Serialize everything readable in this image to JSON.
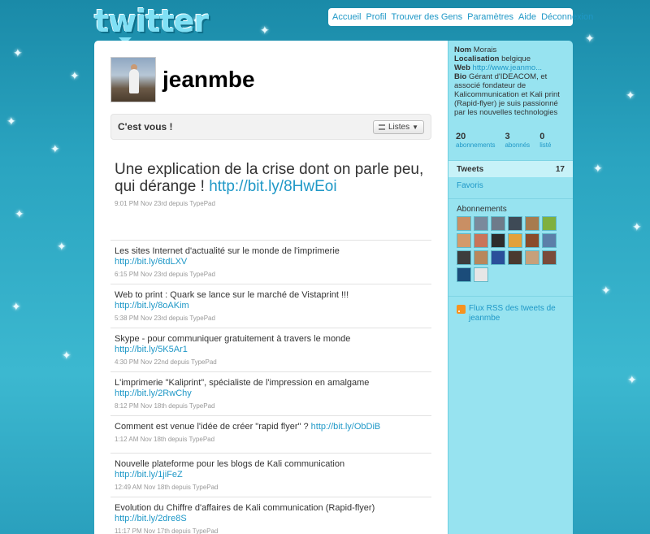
{
  "brand": {
    "logo": "twitter"
  },
  "nav": {
    "items": [
      "Accueil",
      "Profil",
      "Trouver des Gens",
      "Paramètres",
      "Aide",
      "Déconnexion"
    ]
  },
  "profile": {
    "username": "jeanmbe",
    "you_label": "C'est vous !",
    "lists_label": "Listes"
  },
  "latest_tweet": {
    "text": "Une explication de la crise dont on parle peu, qui dérange ! ",
    "link": "http://bit.ly/8HwEoi",
    "meta": "9:01 PM Nov 23rd depuis TypePad"
  },
  "tweets": [
    {
      "text": "Les sites Internet d'actualité sur le monde de l'imprimerie",
      "link": "http://bit.ly/6tdLXV",
      "meta": "6:15 PM Nov 23rd depuis TypePad"
    },
    {
      "text": "Web to print : Quark se lance sur le marché de Vistaprint !!!",
      "link": "http://bit.ly/8oAKim",
      "meta": "5:38 PM Nov 23rd depuis TypePad"
    },
    {
      "text": "Skype - pour communiquer gratuitement à travers le monde",
      "link": "http://bit.ly/5K5Ar1",
      "meta": "4:30 PM Nov 22nd depuis TypePad"
    },
    {
      "text": "L'imprimerie \"Kaliprint\", spécialiste de l'impression en amalgame",
      "link": "http://bit.ly/2RwChy",
      "meta": "8:12 PM Nov 18th depuis TypePad"
    },
    {
      "text": "Comment est venue l'idée de créer \"rapid flyer\" ? ",
      "link": "http://bit.ly/ObDiB",
      "meta": "1:12 AM Nov 18th depuis TypePad",
      "inline": true
    },
    {
      "text": "Nouvelle plateforme pour les blogs de Kali communication",
      "link": "http://bit.ly/1jiFeZ",
      "meta": "12:49 AM Nov 18th depuis TypePad"
    },
    {
      "text": "Evolution du Chiffre d'affaires de Kali communication (Rapid-flyer)",
      "link": "http://bit.ly/2dre8S",
      "meta": "11:17 PM Nov 17th depuis TypePad"
    }
  ],
  "sidebar": {
    "name_label": "Nom",
    "name": "Morais",
    "location_label": "Localisation",
    "location": "belgique",
    "web_label": "Web",
    "web": "http://www.jeanmo...",
    "bio_label": "Bio",
    "bio": "Gérant d'IDEACOM, et associé fondateur de Kalicommunication et Kali print (Rapid-flyer) je suis passionné par les nouvelles technologies",
    "stats": [
      {
        "n": "20",
        "label": "abonnements"
      },
      {
        "n": "3",
        "label": "abonnés"
      },
      {
        "n": "0",
        "label": "listé"
      }
    ],
    "tweets_label": "Tweets",
    "tweets_count": "17",
    "favorites_label": "Favoris",
    "following_title": "Abonnements",
    "rss": "Flux RSS des tweets de jeanmbe"
  }
}
